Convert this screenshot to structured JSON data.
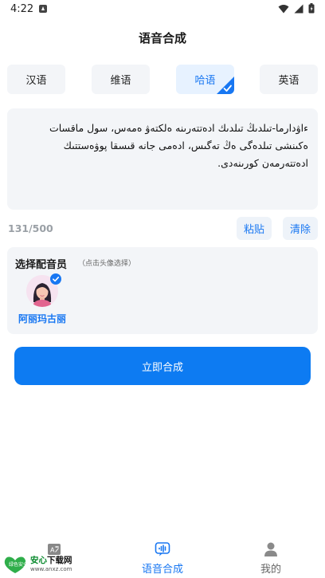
{
  "status_bar": {
    "time": "4:22",
    "icons": [
      "notification-icon",
      "wifi-icon",
      "signal-icon",
      "battery-icon"
    ]
  },
  "header": {
    "title": "语音合成"
  },
  "language_tabs": [
    {
      "label": "汉语",
      "selected": false
    },
    {
      "label": "维语",
      "selected": false
    },
    {
      "label": "哈语",
      "selected": true
    },
    {
      "label": "英语",
      "selected": false
    }
  ],
  "editor": {
    "lines": [
      "ءاۋدارما-تىلدىڭ تىلدىك ادەتتەرىنە ەلكتەۋ ەمەس، سول ماقسات",
      "ەكىنشى تىلدەگى ەڭ تەگىس، ادەمى جانە قىسقا پوۋەستتىك",
      "ادەتتەرمەن كورىنەدى."
    ],
    "char_count": "131/500",
    "paste_label": "粘贴",
    "clear_label": "清除"
  },
  "speaker_panel": {
    "title": "选择配音员",
    "hint": "（点击头像选择）",
    "selected_speaker": {
      "name": "阿丽玛古丽",
      "selected": true
    }
  },
  "actions": {
    "synthesize_label": "立即合成"
  },
  "bottom_nav": [
    {
      "label": "",
      "icon": "translate-icon",
      "active": false
    },
    {
      "label": "语音合成",
      "icon": "voice-synthesis-icon",
      "active": true
    },
    {
      "label": "我的",
      "icon": "person-icon",
      "active": false
    }
  ],
  "watermark": {
    "title_green": "安心",
    "title_dark": "下载网",
    "url": "www.anxz.com",
    "logo_text": "绿色安全"
  },
  "colors": {
    "accent": "#1877f2",
    "button": "#0d7bf2",
    "panel_bg": "#f3f5f8",
    "active_tab_bg": "#e7f2ff"
  }
}
